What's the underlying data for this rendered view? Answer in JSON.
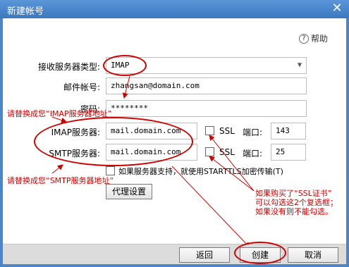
{
  "window": {
    "title": "新建帐号",
    "close_glyph": "✕"
  },
  "help": {
    "label": "帮助",
    "icon": "question-circle-icon"
  },
  "form": {
    "server_type_label": "接收服务器类型:",
    "server_type_value": "IMAP",
    "account_label": "邮件帐号:",
    "account_value": "zhangsan@domain.com",
    "password_label": "密码:",
    "password_value": "********",
    "imap_label": "IMAP服务器:",
    "imap_value": "mail.domain.com",
    "imap_ssl": "SSL",
    "imap_port_label": "端口:",
    "imap_port": "143",
    "smtp_label": "SMTP服务器:",
    "smtp_value": "mail.domain.com",
    "smtp_ssl": "SSL",
    "smtp_port_label": "端口:",
    "smtp_port": "25",
    "starttls_label": "如果服务器支持，就使用STARTTLS加密传输(T)",
    "proxy_button": "代理设置"
  },
  "footer": {
    "back": "返回",
    "create": "创建",
    "cancel": "取消"
  },
  "annotations": {
    "imap_hint": "请替换成您“IMAP服务器地址”",
    "smtp_hint": "请替换成您“SMTP服务器地址”",
    "ssl_hint_1": "如果购买了“SSL证书”",
    "ssl_hint_2": "可以勾选这2个复选框；",
    "ssl_hint_3": "如果没有则不能勾选。",
    "color": "#d00000"
  }
}
